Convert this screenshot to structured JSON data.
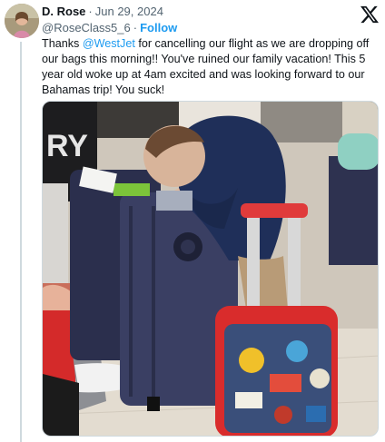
{
  "tweet": {
    "display_name": "D. Rose",
    "separator": "·",
    "date": "Jun 29, 2024",
    "handle": "@RoseClass5_6",
    "follow_separator": "·",
    "follow_label": "Follow",
    "text_part1": "Thanks ",
    "mention": "@WestJet",
    "text_part2": " for cancelling our flight as we are dropping off our bags this morning!! You've ruined our family vacation! This 5 year old  woke up at 4am excited and was looking forward to our Bahamas trip! You suck!",
    "photo_alt": "Child asleep leaning on luggage at the airport"
  },
  "icons": {
    "brand": "x-logo-icon",
    "avatar": "profile-avatar"
  },
  "colors": {
    "link": "#1d9bf0",
    "text": "#0f1419",
    "muted": "#536471",
    "border": "#cfd9de"
  }
}
